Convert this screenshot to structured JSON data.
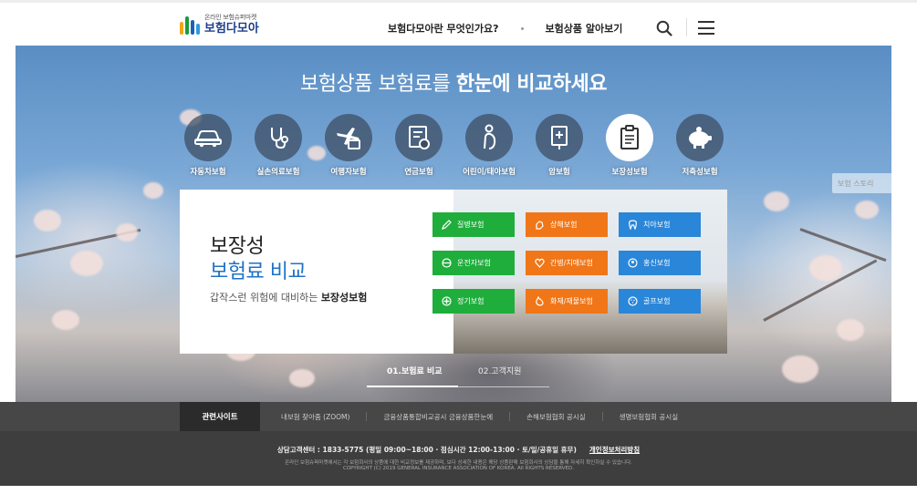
{
  "header": {
    "logo_sub": "온라인 보험슈퍼마켓",
    "logo_main": "보험다모아",
    "nav": [
      "보험다모아란 무엇인가요?",
      "보험상품 알아보기"
    ]
  },
  "hero": {
    "title_normal": "보험상품 보험료를 ",
    "title_bold": "한눈에 비교하세요",
    "categories": [
      {
        "label": "자동차보험",
        "icon": "car-icon"
      },
      {
        "label": "실손의료보험",
        "icon": "stethoscope-icon"
      },
      {
        "label": "여행자보험",
        "icon": "travel-icon"
      },
      {
        "label": "연금보험",
        "icon": "pension-icon"
      },
      {
        "label": "어린이/태아보험",
        "icon": "child-icon"
      },
      {
        "label": "암보험",
        "icon": "cancer-icon"
      },
      {
        "label": "보장성보험",
        "icon": "clipboard-icon"
      },
      {
        "label": "저축성보험",
        "icon": "piggy-bank-icon"
      }
    ],
    "active_category": "보장성보험",
    "side_hint": "보험 스토리"
  },
  "panel": {
    "title_line1": "보장성",
    "title_line2": "보험료 비교",
    "desc_normal": "갑작스런 위험에 대비하는 ",
    "desc_bold": "보장성보험",
    "buttons": [
      {
        "label": "질병보험",
        "color": "green",
        "icon": "pen-icon"
      },
      {
        "label": "상해보험",
        "color": "orange",
        "icon": "hand-icon"
      },
      {
        "label": "치아보험",
        "color": "blue",
        "icon": "tooth-icon"
      },
      {
        "label": "운전자보험",
        "color": "green",
        "icon": "steering-icon"
      },
      {
        "label": "간병/치매보험",
        "color": "orange",
        "icon": "heart-icon"
      },
      {
        "label": "홍신보험",
        "color": "blue",
        "icon": "person-icon"
      },
      {
        "label": "정기보험",
        "color": "green",
        "icon": "cross-icon"
      },
      {
        "label": "화재/재물보험",
        "color": "orange",
        "icon": "fire-icon"
      },
      {
        "label": "골프보험",
        "color": "blue",
        "icon": "golf-icon"
      }
    ]
  },
  "tabs": [
    "01.보험료 비교",
    "02.고객지원"
  ],
  "related": {
    "title": "관련사이트",
    "links": [
      "내보험 찾아줌 (ZOOM)",
      "금융상품통합비교공시 금융상품한눈에",
      "손해보험협회 공시실",
      "생명보험협회 공시실"
    ]
  },
  "footer": {
    "contact": "상담고객센터 : 1833-5775 (평일 09:00~18:00 · 점심시간 12:00-13:00 · 토/일/공휴일 휴무)",
    "privacy": "개인정보처리방침",
    "notice": "온라인 보험슈퍼마켓에서는 각 보험회사의 상품에 대한 비교정보를 제공하며, 보다 상세한 내용은 해당 상품판매 보험회사의 상담을 통해 자세히 확인하실 수 있습니다.",
    "copyright": "COPYRIGHT (C) 2019 GENERAL INSURANCE ASSOCIATION OF KOREA. All RIGHTS RESERVED."
  },
  "colors": {
    "green": "#1fae3c",
    "orange": "#f07617",
    "blue": "#2a86d8",
    "brand": "#1d3f8c",
    "accent": "#1f72c6"
  }
}
